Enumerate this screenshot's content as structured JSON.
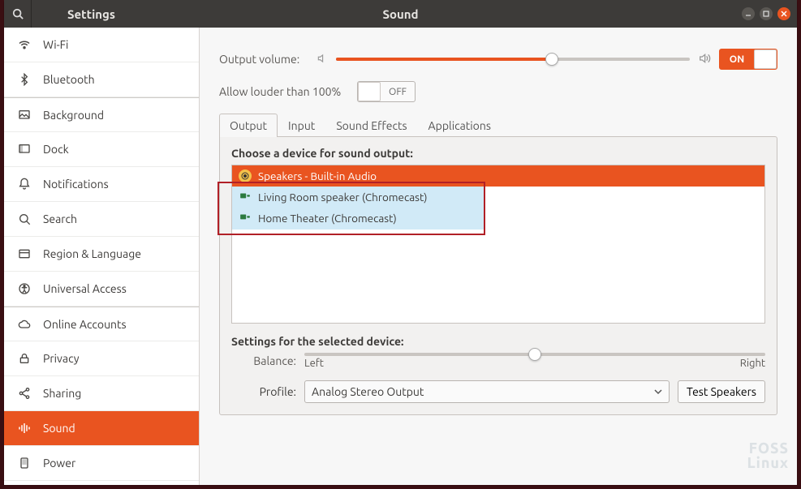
{
  "titlebar": {
    "app": "Settings",
    "page": "Sound"
  },
  "sidebar": {
    "items": [
      {
        "label": "Wi-Fi"
      },
      {
        "label": "Bluetooth"
      },
      {
        "label": "Background"
      },
      {
        "label": "Dock"
      },
      {
        "label": "Notifications"
      },
      {
        "label": "Search"
      },
      {
        "label": "Region & Language"
      },
      {
        "label": "Universal Access"
      },
      {
        "label": "Online Accounts"
      },
      {
        "label": "Privacy"
      },
      {
        "label": "Sharing"
      },
      {
        "label": "Sound"
      },
      {
        "label": "Power"
      }
    ],
    "active_index": 11
  },
  "output_volume": {
    "label": "Output volume:",
    "percent": 61,
    "toggle": "ON"
  },
  "louder": {
    "label": "Allow louder than 100%",
    "toggle": "OFF"
  },
  "tabs": {
    "items": [
      "Output",
      "Input",
      "Sound Effects",
      "Applications"
    ],
    "active_index": 0
  },
  "output_panel": {
    "choose_label": "Choose a device for sound output:",
    "devices": [
      {
        "label": "Speakers - Built-in Audio",
        "selected": true,
        "type": "speaker"
      },
      {
        "label": "Living Room speaker (Chromecast)",
        "selected": false,
        "type": "network"
      },
      {
        "label": "Home Theater (Chromecast)",
        "selected": false,
        "type": "network"
      }
    ]
  },
  "balance": {
    "section_label": "Settings for the selected device:",
    "label": "Balance:",
    "left": "Left",
    "right": "Right",
    "percent": 50
  },
  "profile": {
    "label": "Profile:",
    "value": "Analog Stereo Output",
    "test_button": "Test Speakers"
  },
  "watermark": {
    "line1": "FOSS",
    "line2": "Linux"
  }
}
